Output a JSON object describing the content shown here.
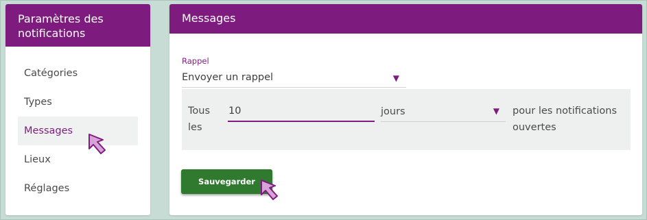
{
  "sidebar": {
    "title": "Paramètres des notifications",
    "items": [
      {
        "label": "Catégories"
      },
      {
        "label": "Types"
      },
      {
        "label": "Messages"
      },
      {
        "label": "Lieux"
      },
      {
        "label": "Réglages"
      }
    ],
    "active_index": 2
  },
  "main": {
    "title": "Messages",
    "rappel": {
      "label": "Rappel",
      "selected": "Envoyer un rappel"
    },
    "repeat": {
      "prefix": "Tous les",
      "days_value": "10",
      "unit_selected": "jours",
      "suffix": "pour les notifications ouvertes"
    },
    "save_label": "Sauvegarder"
  },
  "colors": {
    "brand": "#7e1b7e",
    "save": "#2f7a2f",
    "background": "#c8dcd6"
  },
  "icons": {
    "caret": "chevron-down-icon",
    "cursor": "pointer-arrow-icon"
  }
}
